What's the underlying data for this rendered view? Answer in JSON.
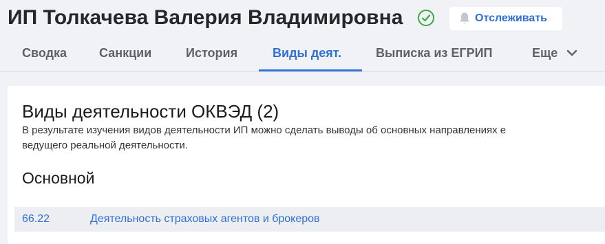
{
  "header": {
    "title": "ИП Толкачева Валерия Владимировна",
    "follow_label": "Отслеживать"
  },
  "tabs": [
    {
      "label": "Сводка"
    },
    {
      "label": "Санкции"
    },
    {
      "label": "История"
    },
    {
      "label": "Виды деят."
    },
    {
      "label": "Выписка из ЕГРИП"
    },
    {
      "label": "Еще"
    }
  ],
  "active_tab": "Виды деят.",
  "card": {
    "title": "Виды деятельности ОКВЭД (2)",
    "description_line1": "В результате изучения видов деятельности ИП можно сделать выводы об основных направлениях е",
    "description_line2": "ведущего реальной деятельности.",
    "section_title": "Основной",
    "rows": [
      {
        "code": "66.22",
        "name": "Деятельность страховых агентов и брокеров"
      }
    ]
  },
  "colors": {
    "accent": "#2f6fd6",
    "verified_green": "#3aa845",
    "page_bg": "#f0f2f5",
    "row_bg": "#eceef2"
  },
  "icons": {
    "verified": "check-circle-icon",
    "follow": "bell-icon",
    "more": "chevron-down-icon"
  }
}
